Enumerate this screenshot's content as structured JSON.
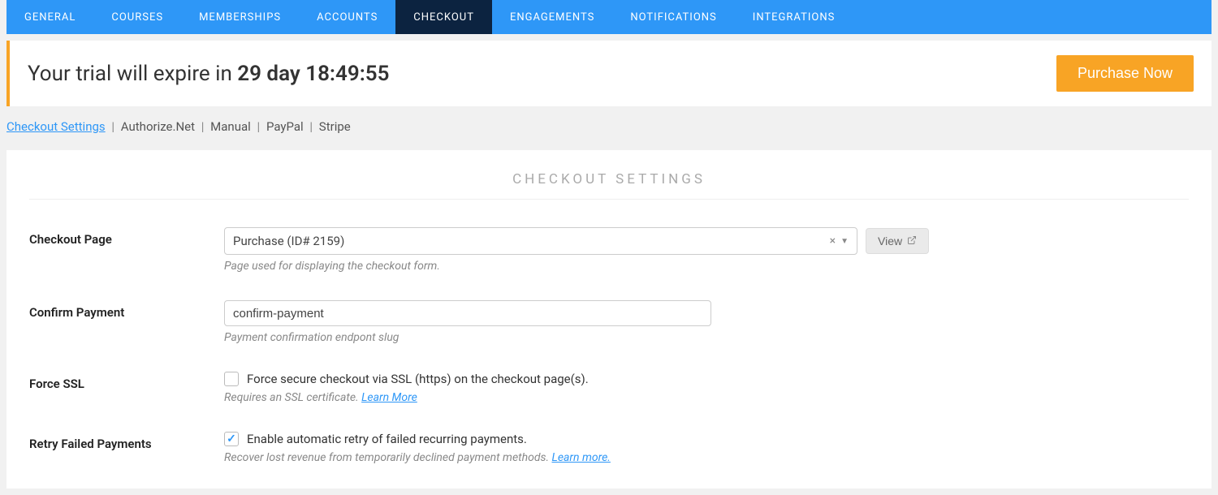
{
  "nav": {
    "items": [
      "GENERAL",
      "COURSES",
      "MEMBERSHIPS",
      "ACCOUNTS",
      "CHECKOUT",
      "ENGAGEMENTS",
      "NOTIFICATIONS",
      "INTEGRATIONS"
    ],
    "active_index": 4
  },
  "trial": {
    "prefix": "Your trial will expire in ",
    "remaining": "29 day 18:49:55",
    "purchase_label": "Purchase Now"
  },
  "breadcrumb": {
    "active": "Checkout Settings",
    "others": [
      "Authorize.Net",
      "Manual",
      "PayPal",
      "Stripe"
    ]
  },
  "panel": {
    "title": "CHECKOUT SETTINGS"
  },
  "checkout_page": {
    "label": "Checkout Page",
    "value": "Purchase (ID# 2159)",
    "helper": "Page used for displaying the checkout form.",
    "view_label": "View"
  },
  "confirm_payment": {
    "label": "Confirm Payment",
    "value": "confirm-payment",
    "helper": "Payment confirmation endpont slug"
  },
  "force_ssl": {
    "label": "Force SSL",
    "check_label": "Force secure checkout via SSL (https) on the checkout page(s).",
    "checked": false,
    "helper_text": "Requires an SSL certificate. ",
    "helper_link": "Learn More"
  },
  "retry": {
    "label": "Retry Failed Payments",
    "check_label": "Enable automatic retry of failed recurring payments.",
    "checked": true,
    "helper_text": "Recover lost revenue from temporarily declined payment methods. ",
    "helper_link": "Learn more."
  }
}
